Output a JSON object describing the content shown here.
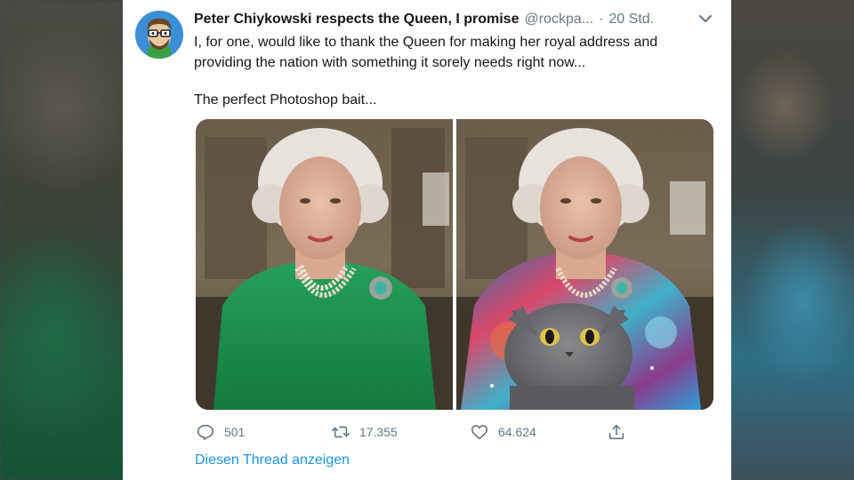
{
  "tweet": {
    "author_name": "Peter Chiykowski respects the Queen, I promise",
    "handle": "@rockpa...",
    "separator": "·",
    "time": "20 Std.",
    "text_line1": "I, for one, would like to thank the Queen for making her royal address and providing the nation with something it sorely needs right now...",
    "text_line2": "The perfect Photoshop bait..."
  },
  "actions": {
    "replies": "501",
    "retweets": "17.355",
    "likes": "64.624"
  },
  "links": {
    "show_thread": "Diesen Thread anzeigen"
  },
  "colors": {
    "link": "#1b95e0",
    "secondary_text": "#657786",
    "primary_text": "#14171a",
    "dress_green": "#1e8a4c"
  },
  "icons": {
    "reply": "speech-bubble-icon",
    "retweet": "retweet-arrows-icon",
    "like": "heart-icon",
    "share": "share-upload-icon",
    "menu": "chevron-down-icon"
  }
}
